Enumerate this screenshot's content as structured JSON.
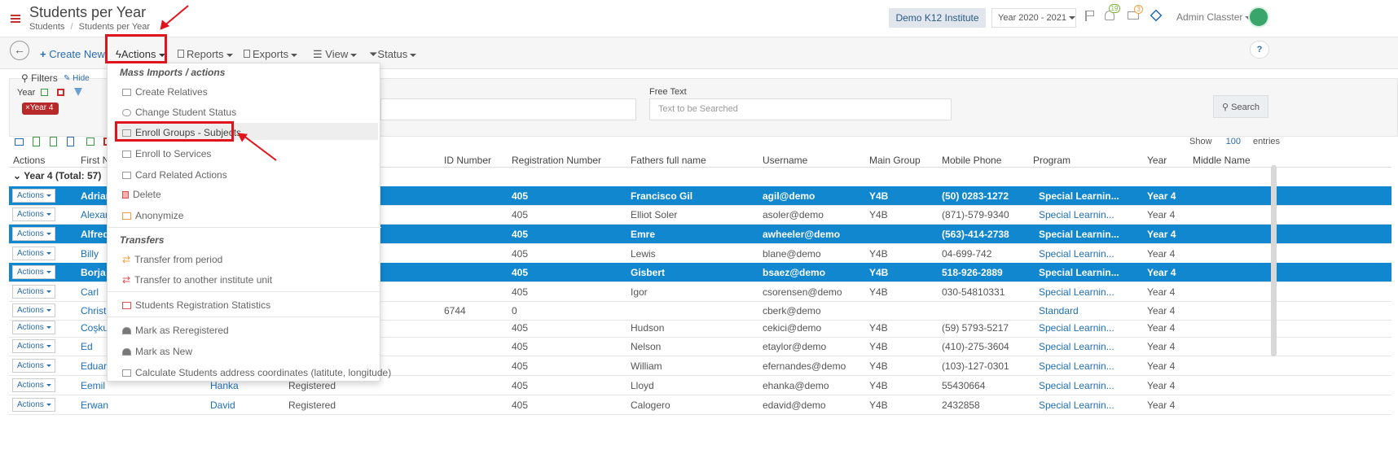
{
  "page": {
    "title": "Students per Year",
    "breadcrumb": [
      "Students",
      "Students per Year"
    ]
  },
  "header": {
    "institute": "Demo K12 Institute",
    "year_select": "Year 2020 - 2021",
    "notif_count": "19",
    "mail_count": "3",
    "user": "Admin Classter"
  },
  "toolbar": {
    "create_new": "Create New",
    "actions": "Actions",
    "reports": "Reports",
    "exports": "Exports",
    "view": "View",
    "status": "Status",
    "help": "?"
  },
  "filters": {
    "title": "Filters",
    "hide": "Hide",
    "year_label": "Year",
    "year_chip": "Year 4",
    "free_text_label": "Free Text",
    "free_text_placeholder": "Text to be Searched",
    "search": "Search"
  },
  "table_controls": {
    "show": "Show",
    "entries_count": "100",
    "entries": "entries"
  },
  "columns": [
    "Actions",
    "First Na",
    "ID Number",
    "Registration Number",
    "Fathers full name",
    "Username",
    "Main Group",
    "Mobile Phone",
    "Program",
    "Year",
    "Middle Name"
  ],
  "group_header": "Year 4 (Total: 57)",
  "row_action_label": "Actions",
  "rows": [
    {
      "first": "Adrian",
      "last": "",
      "status": "",
      "id": "",
      "reg": "405",
      "father": "Francisco Gil",
      "user": "agil@demo",
      "group": "Y4B",
      "phone": "(50) 0283-1272",
      "program": "Special Learnin...",
      "year": "Year 4",
      "selected": true
    },
    {
      "first": "Alexan",
      "last": "",
      "status": "",
      "id": "",
      "reg": "405",
      "father": "Elliot Soler",
      "user": "asoler@demo",
      "group": "Y4B",
      "phone": "(871)-579-9340",
      "program": "Special Learnin...",
      "year": "Year 4",
      "selected": false
    },
    {
      "first": "Alfred",
      "last": "",
      "status": "",
      "id": "",
      "reg": "405",
      "father": "Emre",
      "user": "awheeler@demo",
      "group": "",
      "phone": "(563)-414-2738",
      "program": "Special Learnin...",
      "year": "Year 4",
      "selected": true
    },
    {
      "first": "Billy",
      "last": "",
      "status": "",
      "id": "",
      "reg": "405",
      "father": "Lewis",
      "user": "blane@demo",
      "group": "Y4B",
      "phone": "04-699-742",
      "program": "Special Learnin...",
      "year": "Year 4",
      "selected": false
    },
    {
      "first": "Borja",
      "last": "",
      "status": "",
      "id": "",
      "reg": "405",
      "father": "Gisbert",
      "user": "bsaez@demo",
      "group": "Y4B",
      "phone": "518-926-2889",
      "program": "Special Learnin...",
      "year": "Year 4",
      "selected": true
    },
    {
      "first": "Carl",
      "last": "",
      "status": "",
      "id": "",
      "reg": "405",
      "father": "Igor",
      "user": "csorensen@demo",
      "group": "Y4B",
      "phone": "030-54810331",
      "program": "Special Learnin...",
      "year": "Year 4",
      "selected": false
    },
    {
      "first": "Christi",
      "last": "",
      "status": "",
      "id": "6744",
      "reg": "0",
      "father": "",
      "user": "cberk@demo",
      "group": "",
      "phone": "",
      "program": "Standard",
      "year": "Year 4",
      "selected": false
    },
    {
      "first": "Coşkur",
      "last": "",
      "status": "",
      "id": "",
      "reg": "405",
      "father": "Hudson",
      "user": "cekici@demo",
      "group": "Y4B",
      "phone": "(59) 5793-5217",
      "program": "Special Learnin...",
      "year": "Year 4",
      "selected": false
    },
    {
      "first": "Ed",
      "last": "",
      "status": "",
      "id": "",
      "reg": "405",
      "father": "Nelson",
      "user": "etaylor@demo",
      "group": "Y4B",
      "phone": "(410)-275-3604",
      "program": "Special Learnin...",
      "year": "Year 4",
      "selected": false
    },
    {
      "first": "Eduart",
      "last": "",
      "status": "",
      "id": "",
      "reg": "405",
      "father": "William",
      "user": "efernandes@demo",
      "group": "Y4B",
      "phone": "(103)-127-0301",
      "program": "Special Learnin...",
      "year": "Year 4",
      "selected": false
    },
    {
      "first": "Eemil",
      "last": "Hanka",
      "status": "Registered",
      "id": "",
      "reg": "405",
      "father": "Lloyd",
      "user": "ehanka@demo",
      "group": "Y4B",
      "phone": "55430664",
      "program": "Special Learnin...",
      "year": "Year 4",
      "selected": false
    },
    {
      "first": "Erwan",
      "last": "David",
      "status": "Registered",
      "id": "",
      "reg": "405",
      "father": "Calogero",
      "user": "edavid@demo",
      "group": "Y4B",
      "phone": "2432858",
      "program": "Special Learnin...",
      "year": "Year 4",
      "selected": false
    }
  ],
  "menu": {
    "section1": "Mass Imports / actions",
    "items1": [
      "Create Relatives",
      "Change Student Status",
      "Enroll Groups - Subjects",
      "Enroll to Services",
      "Card Related Actions",
      "Delete",
      "Anonymize"
    ],
    "section2": "Transfers",
    "items2": [
      "Transfer from period",
      "Transfer to another institute unit"
    ],
    "items3": [
      "Students Registration Statistics"
    ],
    "items4": [
      "Mark as Reregistered",
      "Mark as New",
      "Calculate Students address coordinates (latitute, longitude)"
    ]
  },
  "colors": {
    "accent": "#1187cf",
    "highlight": "#e0141d",
    "brand_red": "#c9302c"
  }
}
